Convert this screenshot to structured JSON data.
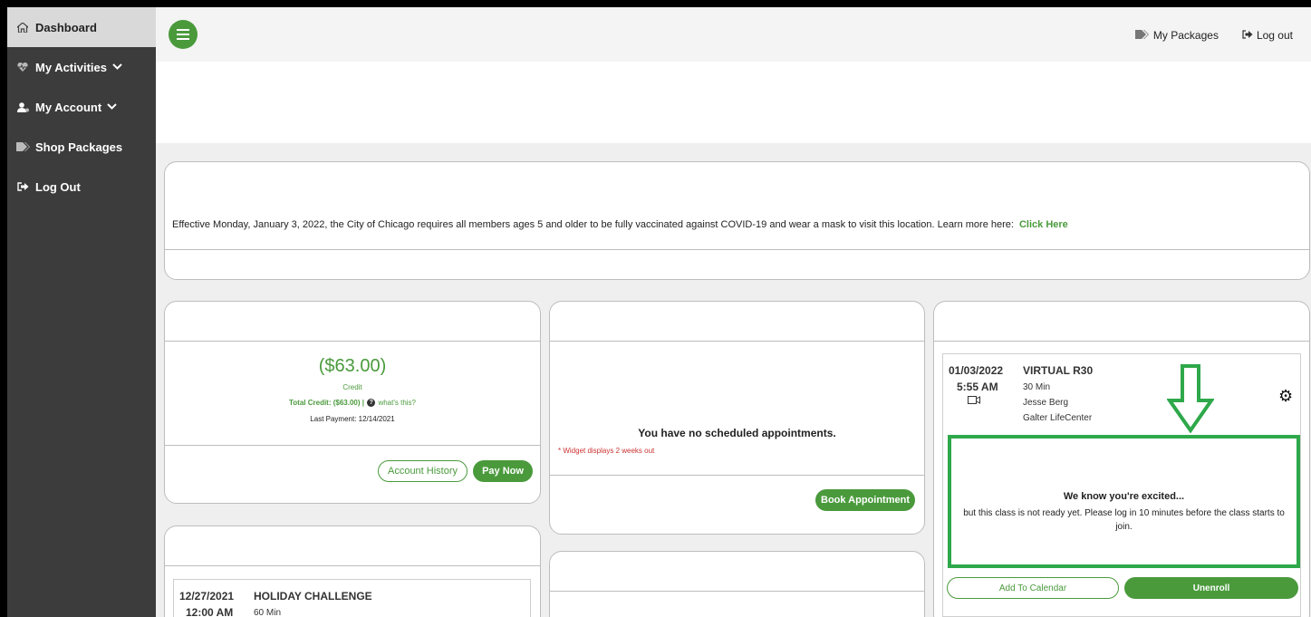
{
  "sidebar": {
    "items": [
      {
        "label": "Dashboard",
        "icon": "home-icon",
        "active": true
      },
      {
        "label": "My Activities",
        "icon": "heartbeat-icon",
        "chevron": true
      },
      {
        "label": "My Account",
        "icon": "user-icon",
        "chevron": true
      },
      {
        "label": "Shop Packages",
        "icon": "tags-icon"
      },
      {
        "label": "Log Out",
        "icon": "logout-icon"
      }
    ]
  },
  "header": {
    "my_packages": "My Packages",
    "log_out": "Log out"
  },
  "notice": {
    "text": "Effective Monday, January 3, 2022, the City of Chicago requires all members ages 5 and older to be fully vaccinated against COVID-19 and wear a mask to visit this location. Learn more here:",
    "link": "Click Here"
  },
  "account": {
    "amount": "($63.00)",
    "credit_label": "Credit",
    "total_credit": "Total Credit: ($63.00) |",
    "whats_this": "what's this?",
    "last_payment": "Last Payment: 12/14/2021",
    "history_button": "Account History",
    "pay_button": "Pay Now"
  },
  "appointments": {
    "empty_text": "You have no scheduled appointments.",
    "widget_note": "* Widget displays 2 weeks out",
    "book_button": "Book Appointment"
  },
  "next_class": {
    "date": "01/03/2022",
    "time": "5:55 AM",
    "name": "VIRTUAL R30",
    "duration": "30 Min",
    "instructor": "Jesse Berg",
    "location": "Galter LifeCenter",
    "excited_title": "We know you're excited...",
    "excited_text": "but this class is not ready yet. Please log in 10 minutes before the class starts to join.",
    "calendar_button": "Add To Calendar",
    "unenroll_button": "Unenroll"
  },
  "past_class": {
    "date": "12/27/2021",
    "time": "12:00 AM",
    "name": "HOLIDAY CHALLENGE",
    "duration": "60 Min"
  },
  "colors": {
    "brand_green": "#4a9a3c",
    "highlight_green": "#2ea84a",
    "sidebar": "#3c3c3c"
  }
}
